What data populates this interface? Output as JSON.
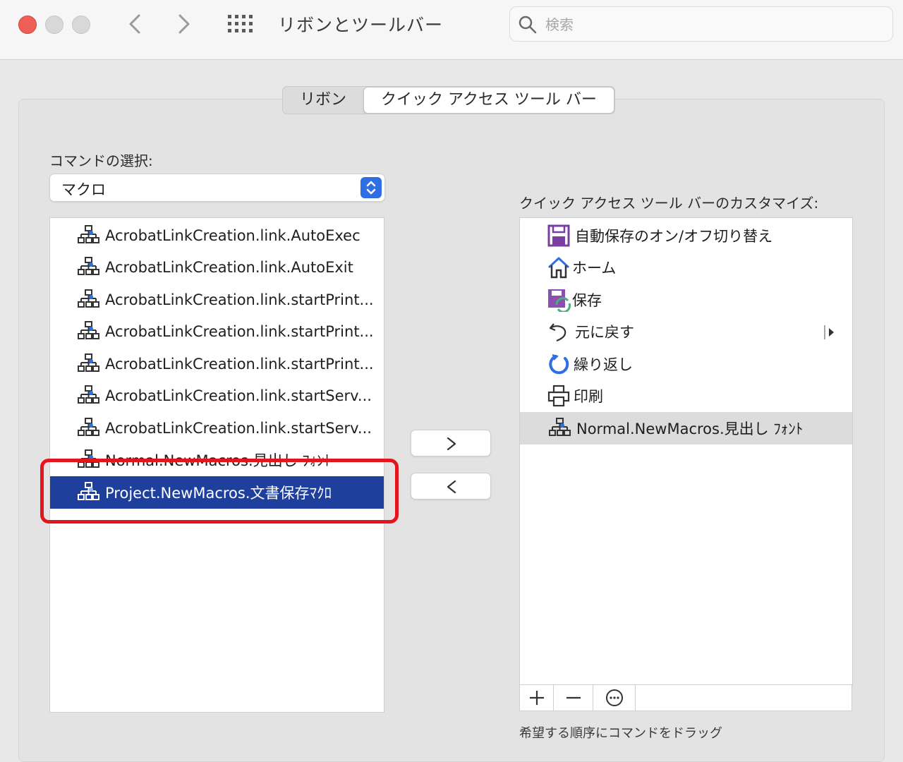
{
  "window": {
    "title": "リボンとツールバー"
  },
  "search": {
    "placeholder": "検索"
  },
  "tabs": [
    {
      "label": "リボン",
      "active": false
    },
    {
      "label": "クイック アクセス ツール バー",
      "active": true
    }
  ],
  "left": {
    "choose_label": "コマンドの選択:",
    "dropdown_value": "マクロ",
    "items": [
      {
        "label": "AcrobatLinkCreation.link.AutoExec",
        "icon": "macro-icon"
      },
      {
        "label": "AcrobatLinkCreation.link.AutoExit",
        "icon": "macro-icon"
      },
      {
        "label": "AcrobatLinkCreation.link.startPrint...",
        "icon": "macro-icon"
      },
      {
        "label": "AcrobatLinkCreation.link.startPrint...",
        "icon": "macro-icon"
      },
      {
        "label": "AcrobatLinkCreation.link.startPrint...",
        "icon": "macro-icon"
      },
      {
        "label": "AcrobatLinkCreation.link.startServ...",
        "icon": "macro-icon"
      },
      {
        "label": "AcrobatLinkCreation.link.startServ...",
        "icon": "macro-icon"
      },
      {
        "label": "Normal.NewMacros.見出し ﾌｫﾝﾄ",
        "icon": "macro-icon"
      },
      {
        "label": "Project.NewMacros.文書保存ﾏｸﾛ",
        "icon": "macro-icon",
        "selected": true
      }
    ]
  },
  "right": {
    "customize_label": "クイック アクセス ツール バーのカスタマイズ:",
    "items": [
      {
        "label": "自動保存のオン/オフ切り替え",
        "icon": "autosave-icon"
      },
      {
        "label": "ホーム",
        "icon": "home-icon"
      },
      {
        "label": "保存",
        "icon": "save-icon"
      },
      {
        "label": "元に戻す",
        "icon": "undo-icon"
      },
      {
        "label": "繰り返し",
        "icon": "redo-icon"
      },
      {
        "label": "印刷",
        "icon": "print-icon"
      },
      {
        "label": "Normal.NewMacros.見出し ﾌｫﾝﾄ",
        "icon": "macro-icon",
        "highlighted": true
      }
    ],
    "hint": "希望する順序にコマンドをドラッグ"
  },
  "colors": {
    "selection": "#1f3f9c",
    "highlight_box": "#e4161b",
    "accent": "#2f6fe4"
  }
}
